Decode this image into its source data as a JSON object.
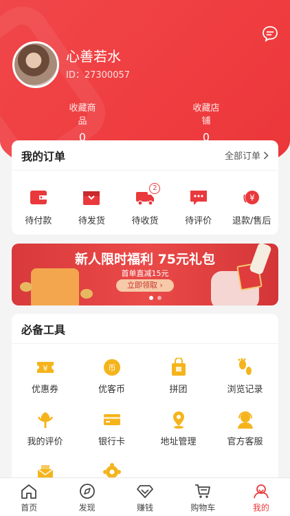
{
  "profile": {
    "nickname": "心善若水",
    "id_text": "ID：27300057",
    "fav_goods_label": "收藏商品",
    "fav_goods_count": "0",
    "fav_shops_label": "收藏店铺",
    "fav_shops_count": "0"
  },
  "orders": {
    "title": "我的订单",
    "all_label": "全部订单",
    "items": [
      {
        "label": "待付款",
        "icon": "wallet-icon"
      },
      {
        "label": "待发货",
        "icon": "package-icon"
      },
      {
        "label": "待收货",
        "icon": "truck-icon",
        "badge": "2"
      },
      {
        "label": "待评价",
        "icon": "comment-icon"
      },
      {
        "label": "退款/售后",
        "icon": "refund-icon"
      }
    ]
  },
  "banner": {
    "title": "新人限时福利 75元礼包",
    "subtitle": "首单直减15元",
    "button": "立即领取 ›"
  },
  "tools": {
    "title": "必备工具",
    "items": [
      {
        "label": "优惠券",
        "icon": "coupon-icon"
      },
      {
        "label": "优客币",
        "icon": "coin-icon"
      },
      {
        "label": "拼团",
        "icon": "group-buy-icon"
      },
      {
        "label": "浏览记录",
        "icon": "footprint-icon"
      },
      {
        "label": "我的评价",
        "icon": "flower-icon"
      },
      {
        "label": "银行卡",
        "icon": "bank-card-icon"
      },
      {
        "label": "地址管理",
        "icon": "location-icon"
      },
      {
        "label": "官方客服",
        "icon": "service-icon"
      },
      {
        "label": "",
        "icon": "mail-icon"
      },
      {
        "label": "",
        "icon": "settings-icon"
      }
    ]
  },
  "tabbar": [
    {
      "label": "首页",
      "icon": "home-icon"
    },
    {
      "label": "发现",
      "icon": "compass-icon"
    },
    {
      "label": "赚钱",
      "icon": "diamond-icon"
    },
    {
      "label": "购物车",
      "icon": "cart-icon"
    },
    {
      "label": "我的",
      "icon": "user-icon",
      "active": true
    }
  ],
  "colors": {
    "accent": "#e9393c",
    "tool_yellow": "#f5b41c"
  }
}
